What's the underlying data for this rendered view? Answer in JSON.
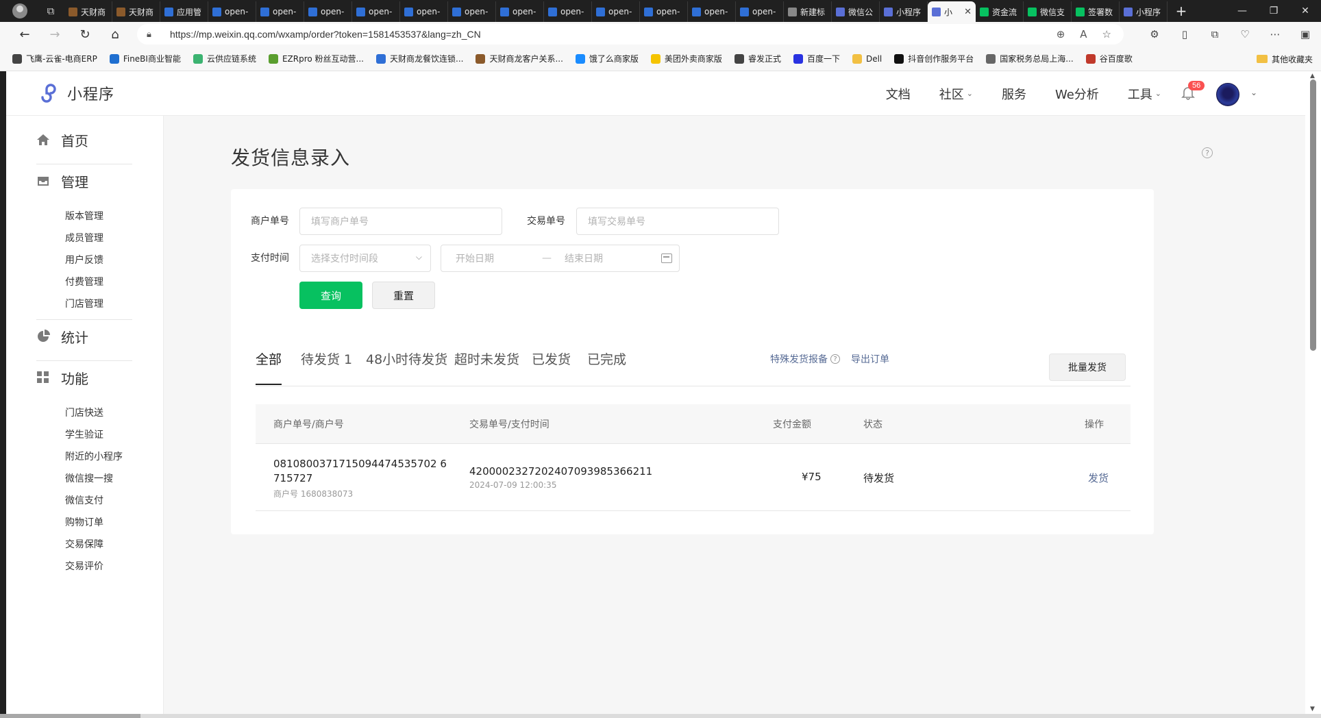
{
  "browser": {
    "tabs": [
      {
        "label": "天财商",
        "color": "#8b5a2b"
      },
      {
        "label": "天财商",
        "color": "#8b5a2b"
      },
      {
        "label": "应用管",
        "color": "#2f6fd6"
      },
      {
        "label": "open-",
        "color": "#2f6fd6"
      },
      {
        "label": "open-",
        "color": "#2f6fd6"
      },
      {
        "label": "open-",
        "color": "#2f6fd6"
      },
      {
        "label": "open-",
        "color": "#2f6fd6"
      },
      {
        "label": "open-",
        "color": "#2f6fd6"
      },
      {
        "label": "open-",
        "color": "#2f6fd6"
      },
      {
        "label": "open-",
        "color": "#2f6fd6"
      },
      {
        "label": "open-",
        "color": "#2f6fd6"
      },
      {
        "label": "open-",
        "color": "#2f6fd6"
      },
      {
        "label": "open-",
        "color": "#2f6fd6"
      },
      {
        "label": "open-",
        "color": "#2f6fd6"
      },
      {
        "label": "open-",
        "color": "#2f6fd6"
      },
      {
        "label": "新建标",
        "color": "#888888"
      },
      {
        "label": "微信公",
        "color": "#5a6fd6"
      },
      {
        "label": "小程序",
        "color": "#5a6fd6"
      },
      {
        "label": "小",
        "color": "#5a6fd6",
        "active": true
      },
      {
        "label": "资金流",
        "color": "#07c160"
      },
      {
        "label": "微信支",
        "color": "#07c160"
      },
      {
        "label": "签署数",
        "color": "#07c160"
      },
      {
        "label": "小程序",
        "color": "#5a6fd6"
      }
    ],
    "url": "https://mp.weixin.qq.com/wxamp/order?token=1581453537&lang=zh_CN",
    "bookmarks": [
      {
        "label": "飞鹰-云雀-电商ERP",
        "color": "#444444"
      },
      {
        "label": "FineBI商业智能",
        "color": "#1f6fd0"
      },
      {
        "label": "云供应链系统",
        "color": "#3cb371"
      },
      {
        "label": "EZRpro 粉丝互动营...",
        "color": "#5a9e2f"
      },
      {
        "label": "天财商龙餐饮连锁...",
        "color": "#2f6fd6"
      },
      {
        "label": "天财商龙客户关系...",
        "color": "#8b5a2b"
      },
      {
        "label": "饿了么商家版",
        "color": "#1a8cff"
      },
      {
        "label": "美团外卖商家版",
        "color": "#f5c400"
      },
      {
        "label": "睿发正式",
        "color": "#444444"
      },
      {
        "label": "百度一下",
        "color": "#2932e1"
      },
      {
        "label": "Dell",
        "color": "#f2c043"
      },
      {
        "label": "抖音创作服务平台",
        "color": "#111111"
      },
      {
        "label": "国家税务总局上海...",
        "color": "#666666"
      },
      {
        "label": "谷百度歌",
        "color": "#c0392b"
      }
    ],
    "bookmarks_more": "›",
    "other_bookmarks": "其他收藏夹"
  },
  "header": {
    "logo_text": "小程序",
    "nav": [
      {
        "label": "文档",
        "dropdown": false
      },
      {
        "label": "社区",
        "dropdown": true
      },
      {
        "label": "服务",
        "dropdown": false
      },
      {
        "label": "We分析",
        "dropdown": false
      },
      {
        "label": "工具",
        "dropdown": true
      }
    ],
    "notification_count": "56"
  },
  "sidebar": {
    "home": "首页",
    "manage": {
      "title": "管理",
      "items": [
        "版本管理",
        "成员管理",
        "用户反馈",
        "付费管理",
        "门店管理"
      ]
    },
    "stats": "统计",
    "features": {
      "title": "功能",
      "items": [
        "门店快送",
        "学生验证",
        "附近的小程序",
        "微信搜一搜",
        "微信支付",
        "购物订单",
        "交易保障",
        "交易评价"
      ]
    }
  },
  "page": {
    "title": "发货信息录入",
    "form": {
      "merchant_no_label": "商户单号",
      "merchant_no_placeholder": "填写商户单号",
      "trade_no_label": "交易单号",
      "trade_no_placeholder": "填写交易单号",
      "pay_time_label": "支付时间",
      "pay_time_select_placeholder": "选择支付时间段",
      "start_date_placeholder": "开始日期",
      "date_separator": "—",
      "end_date_placeholder": "结束日期",
      "query_button": "查询",
      "reset_button": "重置"
    },
    "tabs": [
      "全部",
      "待发货 1",
      "48小时待发货",
      "超时未发货",
      "已发货",
      "已完成"
    ],
    "actions": {
      "special_report": "特殊发货报备",
      "export": "导出订单",
      "batch_ship": "批量发货"
    },
    "table": {
      "columns": [
        "商户单号/商户号",
        "交易单号/支付时间",
        "支付金额",
        "状态",
        "操作"
      ],
      "rows": [
        {
          "merchant_order_line1": "0810800371715094474535702 6",
          "merchant_order_line2": "715727",
          "merchant_id": "商户号 1680838073",
          "transaction_id": "4200002327202407093985366211",
          "pay_time": "2024-07-09 12:00:35",
          "amount": "¥75",
          "status": "待发货",
          "action": "发货"
        }
      ]
    }
  }
}
